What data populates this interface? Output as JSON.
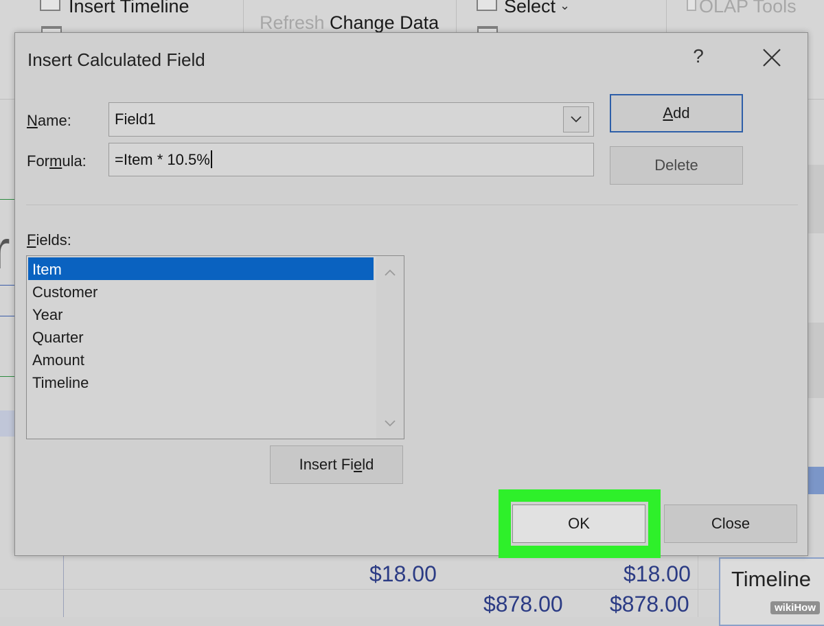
{
  "ribbon": {
    "insert_timeline": "Insert Timeline",
    "refresh": "Refresh",
    "change_data": "Change Data",
    "select": "Select",
    "olap_tools": "OLAP Tools"
  },
  "sheet": {
    "values": [
      "$18.00",
      "$18.00",
      "$878.00",
      "$878.00"
    ],
    "timeline_label": "Timeline",
    "watermark": "wikiHow"
  },
  "dialog": {
    "title": "Insert Calculated Field",
    "help_label": "?",
    "name_label_key": "N",
    "name_label_rest": "ame:",
    "name_value": "Field1",
    "formula_label_pre": "For",
    "formula_label_key": "m",
    "formula_label_post": "ula:",
    "formula_value": "=Item * 10.5%",
    "add_key": "A",
    "add_rest": "dd",
    "delete_label": "Delete",
    "fields_label_key": "F",
    "fields_label_rest": "ields:",
    "fields": [
      "Item",
      "Customer",
      "Year",
      "Quarter",
      "Amount",
      "Timeline"
    ],
    "selected_field": "Item",
    "insert_field_pre": "Insert Fi",
    "insert_field_key": "e",
    "insert_field_post": "ld",
    "ok_label": "OK",
    "close_label": "Close"
  },
  "colors": {
    "accent_blue": "#0a62c0",
    "highlight_green": "#2ef02a",
    "default_button_border": "#2d5ea8"
  }
}
